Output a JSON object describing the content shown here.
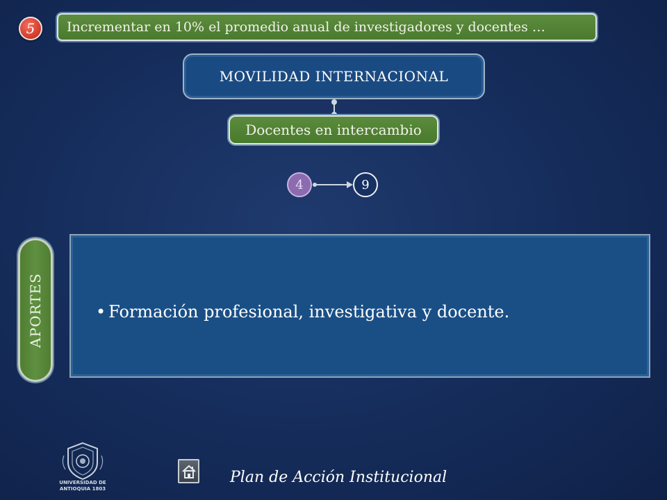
{
  "header": {
    "number": "5",
    "title": "Incrementar en 10% el promedio anual de investigadores y docentes …"
  },
  "diagram": {
    "main_label": "MOVILIDAD INTERNACIONAL",
    "sub_label": "Docentes en intercambio",
    "from_value": "4",
    "to_value": "9"
  },
  "aportes": {
    "tab_label": "APORTES",
    "bullets": [
      "Formación profesional, investigativa y docente."
    ]
  },
  "footer": {
    "text": "Plan de Acción Institucional",
    "logo_text": "UNIVERSIDAD DE ANTIOQUIA 1803",
    "home_icon": "home-icon"
  },
  "colors": {
    "background": "#152c5a",
    "green_box": "#4f7e32",
    "blue_box": "#1a4a82",
    "badge_red": "#d8402e",
    "purple_circle": "#8c6bb0"
  }
}
